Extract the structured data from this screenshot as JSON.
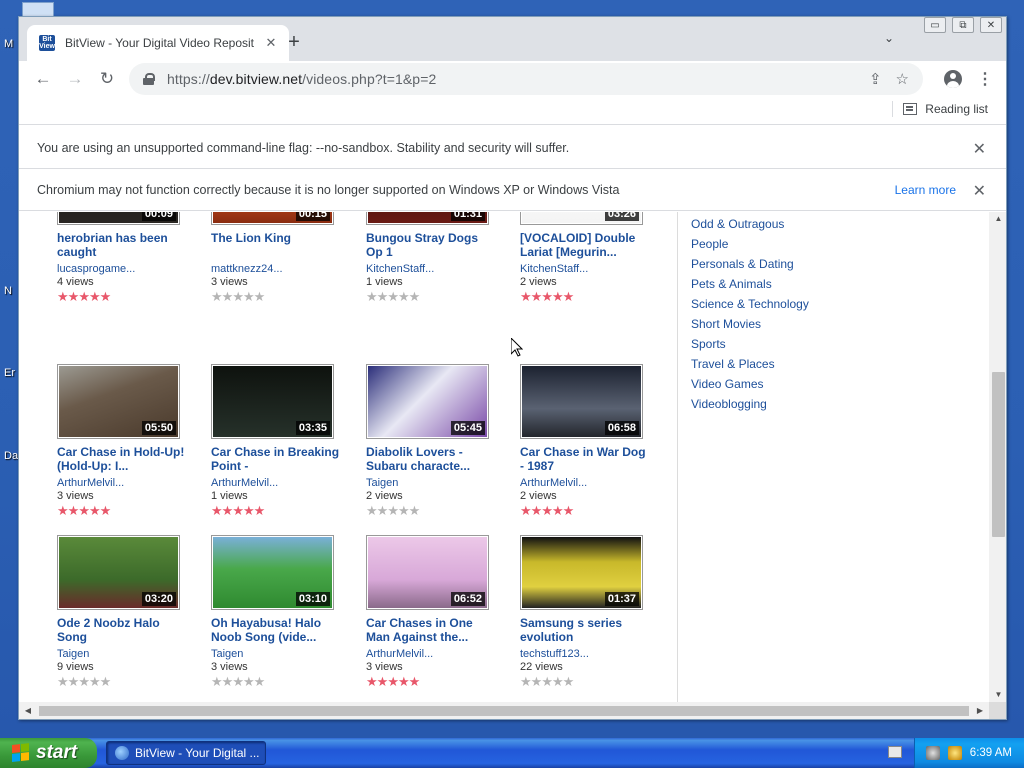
{
  "desktop": {
    "labels": [
      "M",
      "N",
      "Er",
      "Da"
    ]
  },
  "browser": {
    "tab": {
      "favicon_text": "Bit View",
      "title": "BitView - Your Digital Video Reposit"
    },
    "url": {
      "scheme": "https://",
      "host": "dev.bitview.net",
      "path": "/videos.php?t=1&p=2"
    },
    "reading_list_label": "Reading list",
    "infobars": [
      {
        "text": "You are using an unsupported command-line flag: --no-sandbox. Stability and security will suffer."
      },
      {
        "text": "Chromium may not function correctly because it is no longer supported on Windows XP or Windows Vista",
        "link": "Learn more"
      }
    ]
  },
  "videos": [
    {
      "title": "herobrian has been caught",
      "user": "lucasprogame...",
      "views": "4 views",
      "duration": "00:09",
      "stars": 5
    },
    {
      "title": "The Lion King",
      "user": "mattknezz24...",
      "views": "3 views",
      "duration": "00:15",
      "stars": 0
    },
    {
      "title": "Bungou Stray Dogs Op 1",
      "user": "KitchenStaff...",
      "views": "1 views",
      "duration": "01:31",
      "stars": 0
    },
    {
      "title": "[VOCALOID] Double Lariat [Megurin...",
      "user": "KitchenStaff...",
      "views": "2 views",
      "duration": "03:26",
      "stars": 5
    },
    {
      "title": "Car Chase in Hold-Up! (Hold-Up: I...",
      "user": "ArthurMelvil...",
      "views": "3 views",
      "duration": "05:50",
      "stars": 5
    },
    {
      "title": "Car Chase in Breaking Point -",
      "user": "ArthurMelvil...",
      "views": "1 views",
      "duration": "03:35",
      "stars": 5
    },
    {
      "title": "Diabolik Lovers - Subaru characte...",
      "user": "Taigen",
      "views": "2 views",
      "duration": "05:45",
      "stars": 0
    },
    {
      "title": "Car Chase in War Dog - 1987",
      "user": "ArthurMelvil...",
      "views": "2 views",
      "duration": "06:58",
      "stars": 5
    },
    {
      "title": "Ode 2 Noobz Halo Song",
      "user": "Taigen",
      "views": "9 views",
      "duration": "03:20",
      "stars": 0
    },
    {
      "title": "Oh Hayabusa! Halo Noob Song (vide...",
      "user": "Taigen",
      "views": "3 views",
      "duration": "03:10",
      "stars": 0
    },
    {
      "title": "Car Chases in One Man Against the...",
      "user": "ArthurMelvil...",
      "views": "3 views",
      "duration": "06:52",
      "stars": 5
    },
    {
      "title": "Samsung s series evolution",
      "user": "techstuff123...",
      "views": "22 views",
      "duration": "01:37",
      "stars": 0
    }
  ],
  "categories": [
    "Odd & Outragous",
    "People",
    "Personals & Dating",
    "Pets & Animals",
    "Science & Technology",
    "Short Movies",
    "Sports",
    "Travel & Places",
    "Video Games",
    "Videoblogging"
  ],
  "taskbar": {
    "start_label": "start",
    "task_label": "BitView - Your Digital ...",
    "clock": "6:39 AM"
  },
  "colors": {
    "link": "#1d4f9a",
    "star_on": "#e8576a",
    "star_off": "#b5b5b5"
  }
}
